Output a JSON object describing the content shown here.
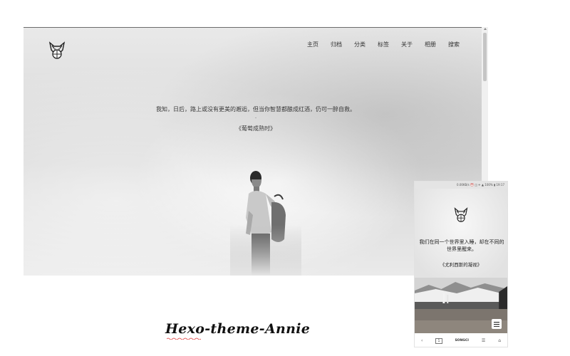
{
  "desktop": {
    "nav": [
      "主页",
      "归档",
      "分类",
      "标签",
      "关于",
      "相册",
      "搜索"
    ],
    "quote": "我知，日后，路上或没有更美的邂逅，但当你智慧都酿成红酒，仍可一醉自救。",
    "quote_separator": "-",
    "quote_source": "《葡萄成熟时》"
  },
  "caption": "Hexo-theme-Annie",
  "mobile": {
    "status_text": "0.00KB/s ⏰ ◫ ✈ ▲ 100% ▮ 19:17",
    "quote": "我们在同一个世界里入睡，却在不同的世界里醒来。",
    "quote_source": "《尤利西斯的凝视》",
    "nav": {
      "back": "‹",
      "tabs": "1",
      "brand": "SONGCI",
      "menu": "☰",
      "home": "⌂"
    }
  },
  "colors": {
    "accent_dark": "#222222",
    "fog_light": "#e9e9e9",
    "fog_mid": "#d6d6d6"
  },
  "icons": [
    "fox-logo-icon",
    "menu-icon",
    "back-icon",
    "tabs-icon",
    "home-icon"
  ]
}
